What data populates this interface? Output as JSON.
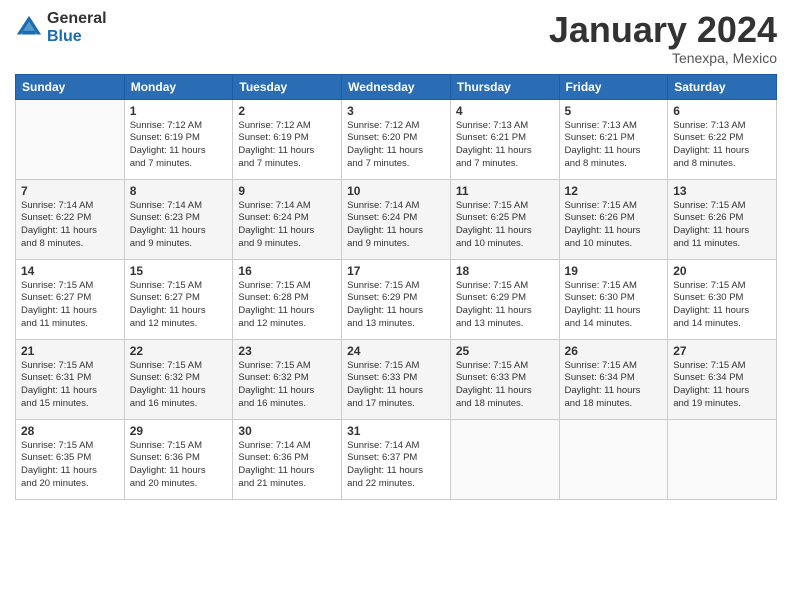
{
  "logo": {
    "general": "General",
    "blue": "Blue"
  },
  "title": "January 2024",
  "location": "Tenexpa, Mexico",
  "headers": [
    "Sunday",
    "Monday",
    "Tuesday",
    "Wednesday",
    "Thursday",
    "Friday",
    "Saturday"
  ],
  "weeks": [
    [
      {
        "day": "",
        "info": ""
      },
      {
        "day": "1",
        "info": "Sunrise: 7:12 AM\nSunset: 6:19 PM\nDaylight: 11 hours\nand 7 minutes."
      },
      {
        "day": "2",
        "info": "Sunrise: 7:12 AM\nSunset: 6:19 PM\nDaylight: 11 hours\nand 7 minutes."
      },
      {
        "day": "3",
        "info": "Sunrise: 7:12 AM\nSunset: 6:20 PM\nDaylight: 11 hours\nand 7 minutes."
      },
      {
        "day": "4",
        "info": "Sunrise: 7:13 AM\nSunset: 6:21 PM\nDaylight: 11 hours\nand 7 minutes."
      },
      {
        "day": "5",
        "info": "Sunrise: 7:13 AM\nSunset: 6:21 PM\nDaylight: 11 hours\nand 8 minutes."
      },
      {
        "day": "6",
        "info": "Sunrise: 7:13 AM\nSunset: 6:22 PM\nDaylight: 11 hours\nand 8 minutes."
      }
    ],
    [
      {
        "day": "7",
        "info": "Sunrise: 7:14 AM\nSunset: 6:22 PM\nDaylight: 11 hours\nand 8 minutes."
      },
      {
        "day": "8",
        "info": "Sunrise: 7:14 AM\nSunset: 6:23 PM\nDaylight: 11 hours\nand 9 minutes."
      },
      {
        "day": "9",
        "info": "Sunrise: 7:14 AM\nSunset: 6:24 PM\nDaylight: 11 hours\nand 9 minutes."
      },
      {
        "day": "10",
        "info": "Sunrise: 7:14 AM\nSunset: 6:24 PM\nDaylight: 11 hours\nand 9 minutes."
      },
      {
        "day": "11",
        "info": "Sunrise: 7:15 AM\nSunset: 6:25 PM\nDaylight: 11 hours\nand 10 minutes."
      },
      {
        "day": "12",
        "info": "Sunrise: 7:15 AM\nSunset: 6:26 PM\nDaylight: 11 hours\nand 10 minutes."
      },
      {
        "day": "13",
        "info": "Sunrise: 7:15 AM\nSunset: 6:26 PM\nDaylight: 11 hours\nand 11 minutes."
      }
    ],
    [
      {
        "day": "14",
        "info": "Sunrise: 7:15 AM\nSunset: 6:27 PM\nDaylight: 11 hours\nand 11 minutes."
      },
      {
        "day": "15",
        "info": "Sunrise: 7:15 AM\nSunset: 6:27 PM\nDaylight: 11 hours\nand 12 minutes."
      },
      {
        "day": "16",
        "info": "Sunrise: 7:15 AM\nSunset: 6:28 PM\nDaylight: 11 hours\nand 12 minutes."
      },
      {
        "day": "17",
        "info": "Sunrise: 7:15 AM\nSunset: 6:29 PM\nDaylight: 11 hours\nand 13 minutes."
      },
      {
        "day": "18",
        "info": "Sunrise: 7:15 AM\nSunset: 6:29 PM\nDaylight: 11 hours\nand 13 minutes."
      },
      {
        "day": "19",
        "info": "Sunrise: 7:15 AM\nSunset: 6:30 PM\nDaylight: 11 hours\nand 14 minutes."
      },
      {
        "day": "20",
        "info": "Sunrise: 7:15 AM\nSunset: 6:30 PM\nDaylight: 11 hours\nand 14 minutes."
      }
    ],
    [
      {
        "day": "21",
        "info": "Sunrise: 7:15 AM\nSunset: 6:31 PM\nDaylight: 11 hours\nand 15 minutes."
      },
      {
        "day": "22",
        "info": "Sunrise: 7:15 AM\nSunset: 6:32 PM\nDaylight: 11 hours\nand 16 minutes."
      },
      {
        "day": "23",
        "info": "Sunrise: 7:15 AM\nSunset: 6:32 PM\nDaylight: 11 hours\nand 16 minutes."
      },
      {
        "day": "24",
        "info": "Sunrise: 7:15 AM\nSunset: 6:33 PM\nDaylight: 11 hours\nand 17 minutes."
      },
      {
        "day": "25",
        "info": "Sunrise: 7:15 AM\nSunset: 6:33 PM\nDaylight: 11 hours\nand 18 minutes."
      },
      {
        "day": "26",
        "info": "Sunrise: 7:15 AM\nSunset: 6:34 PM\nDaylight: 11 hours\nand 18 minutes."
      },
      {
        "day": "27",
        "info": "Sunrise: 7:15 AM\nSunset: 6:34 PM\nDaylight: 11 hours\nand 19 minutes."
      }
    ],
    [
      {
        "day": "28",
        "info": "Sunrise: 7:15 AM\nSunset: 6:35 PM\nDaylight: 11 hours\nand 20 minutes."
      },
      {
        "day": "29",
        "info": "Sunrise: 7:15 AM\nSunset: 6:36 PM\nDaylight: 11 hours\nand 20 minutes."
      },
      {
        "day": "30",
        "info": "Sunrise: 7:14 AM\nSunset: 6:36 PM\nDaylight: 11 hours\nand 21 minutes."
      },
      {
        "day": "31",
        "info": "Sunrise: 7:14 AM\nSunset: 6:37 PM\nDaylight: 11 hours\nand 22 minutes."
      },
      {
        "day": "",
        "info": ""
      },
      {
        "day": "",
        "info": ""
      },
      {
        "day": "",
        "info": ""
      }
    ]
  ]
}
